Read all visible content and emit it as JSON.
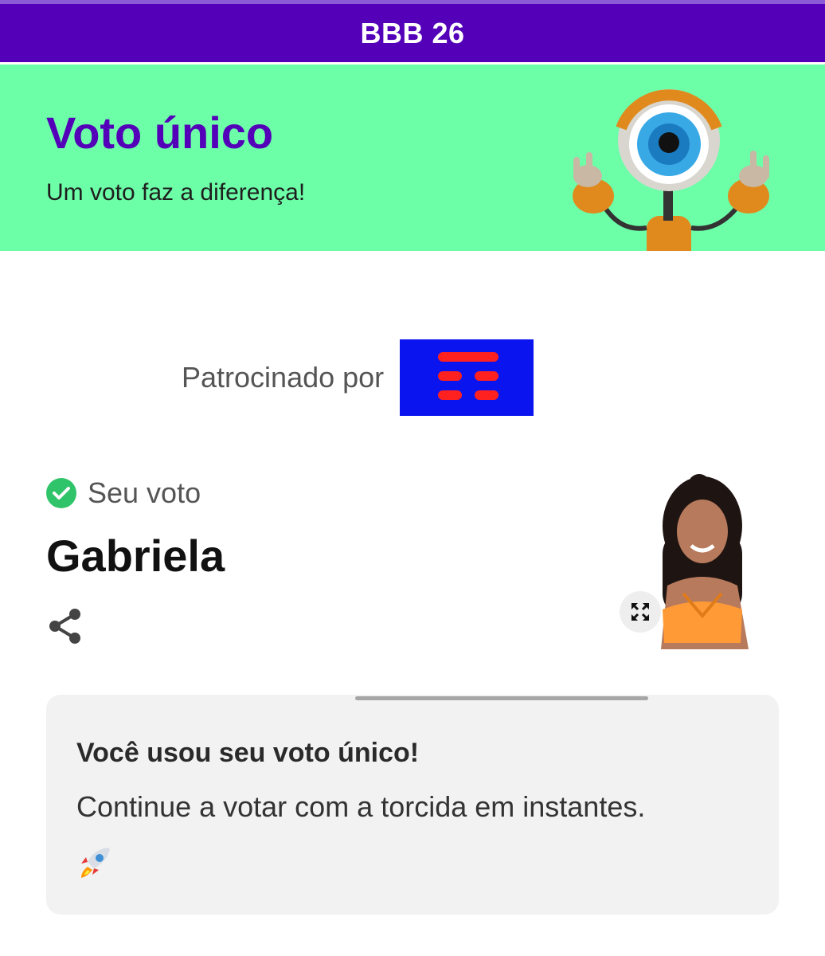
{
  "header": {
    "title": "BBB 26"
  },
  "hero": {
    "title": "Voto único",
    "subtitle": "Um voto faz a diferença!",
    "mascot_icon": "big-brother-eye-mascot",
    "background": "#6cffa8",
    "title_color": "#5300b8"
  },
  "sponsor": {
    "label": "Patrocinado por",
    "logo_icon": "sponsor-logo"
  },
  "vote": {
    "label": "Seu voto",
    "name": "Gabriela",
    "check_icon": "check-circle-icon",
    "share_icon": "share-icon",
    "expand_icon": "expand-icon"
  },
  "card": {
    "title": "Você usou seu voto único!",
    "text": "Continue a votar com a torcida em instantes.",
    "emoji_icon": "rocket-icon"
  },
  "colors": {
    "brand": "#5300b8",
    "accent": "#6cffa8",
    "check": "#2fc36a",
    "card_bg": "#f2f2f2"
  }
}
